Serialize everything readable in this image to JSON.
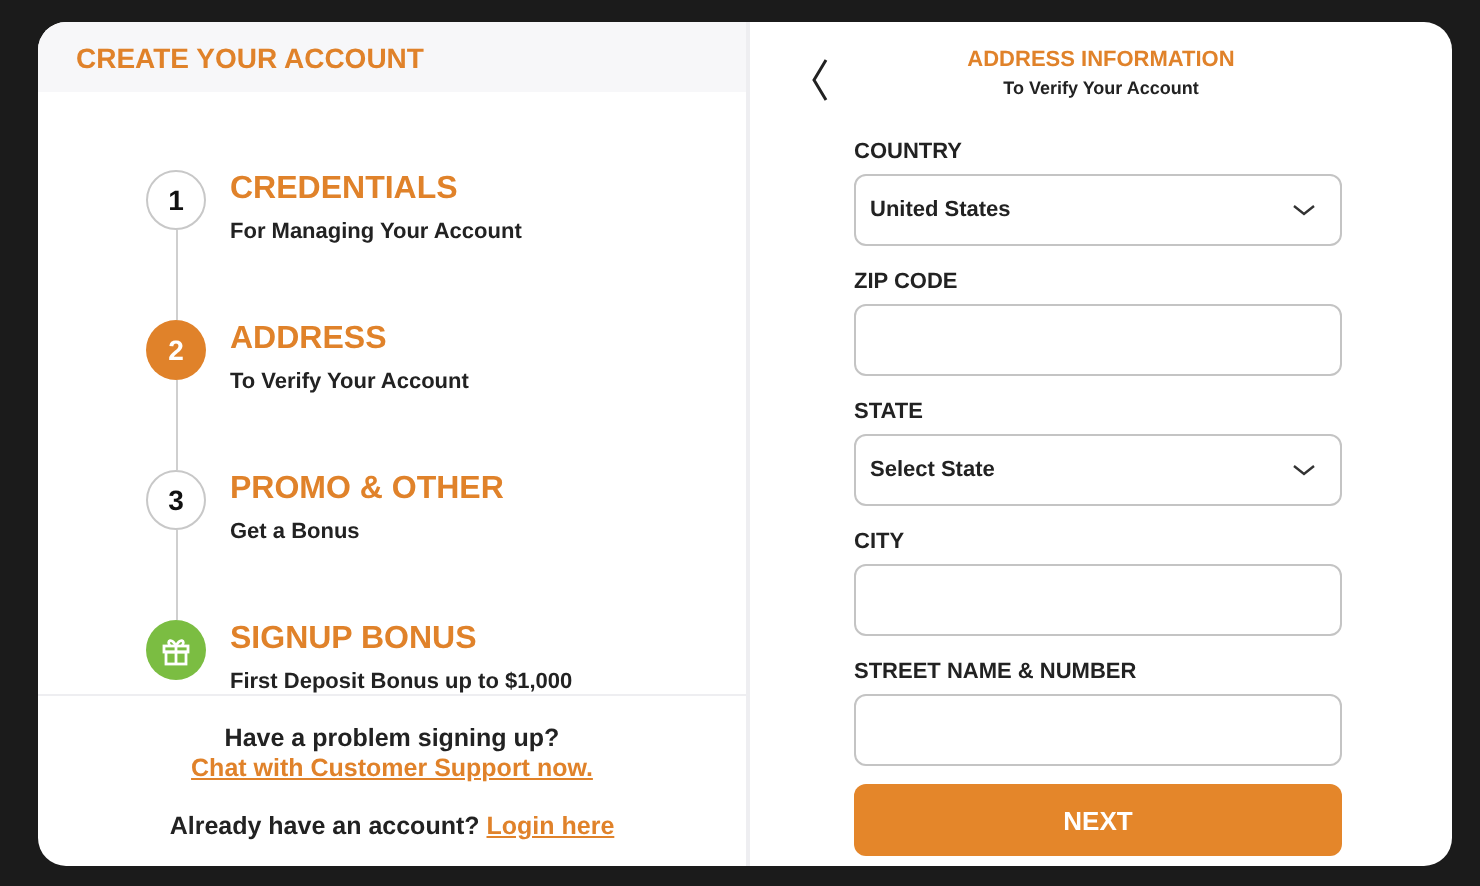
{
  "left_panel": {
    "title": "CREATE YOUR ACCOUNT",
    "steps": [
      {
        "kind": "number",
        "number": "1",
        "title": "CREDENTIALS",
        "subtitle": "For Managing Your Account",
        "selected": false
      },
      {
        "kind": "number",
        "number": "2",
        "title": "ADDRESS",
        "subtitle": "To Verify Your Account",
        "selected": true
      },
      {
        "kind": "number",
        "number": "3",
        "title": "PROMO & OTHER",
        "subtitle": "Get a Bonus",
        "selected": false
      },
      {
        "kind": "bonus",
        "title": "SIGNUP BONUS",
        "subtitle": "First Deposit Bonus up to $1,000"
      }
    ],
    "help": {
      "text": "Have a problem signing up?",
      "link": "Chat with Customer Support now."
    },
    "login": {
      "text": "Already have an account?",
      "link": "Login here"
    }
  },
  "right_panel": {
    "title": "ADDRESS INFORMATION",
    "subtitle": "To Verify Your Account",
    "fields": [
      {
        "kind": "select",
        "label": "COUNTRY",
        "value": "United States"
      },
      {
        "kind": "text",
        "label": "ZIP CODE"
      },
      {
        "kind": "select",
        "label": "STATE",
        "value": "Select State"
      },
      {
        "kind": "text",
        "label": "CITY"
      },
      {
        "kind": "text",
        "label": "STREET NAME & NUMBER"
      }
    ],
    "button": "NEXT"
  }
}
